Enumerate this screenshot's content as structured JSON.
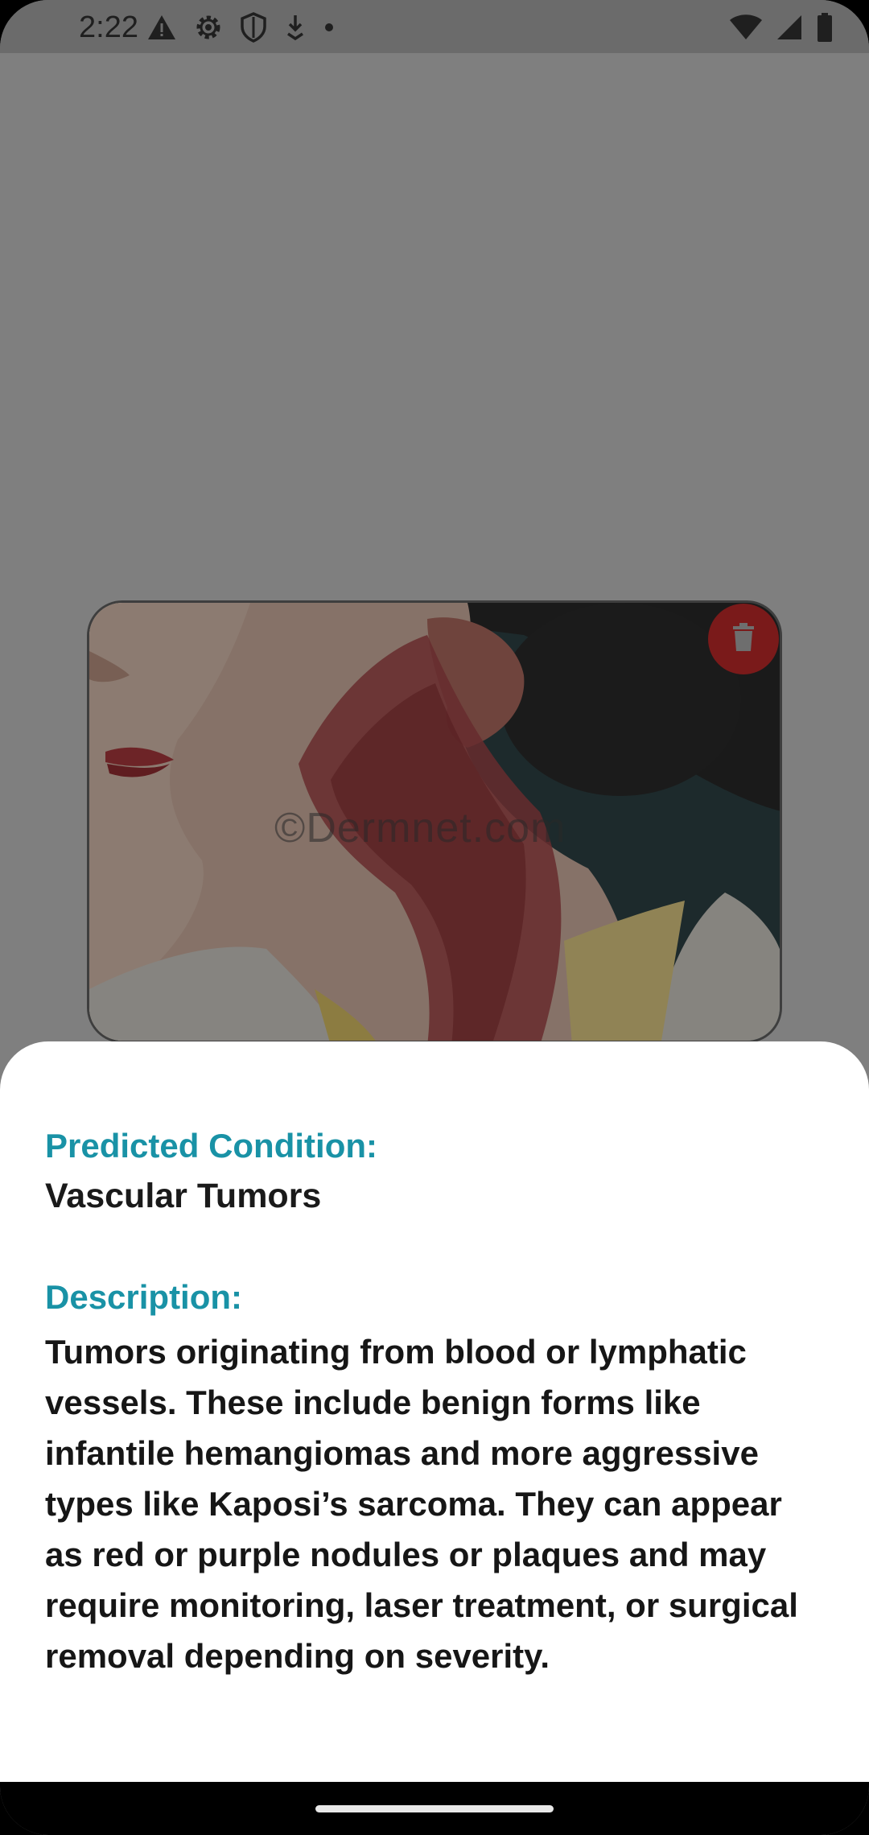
{
  "status_bar": {
    "time": "2:22",
    "left_icons": [
      "warning-icon",
      "gear-icon",
      "shield-icon",
      "download-icon",
      "dot-icon"
    ],
    "right_icons": [
      "wifi-icon",
      "signal-icon",
      "battery-icon"
    ]
  },
  "image": {
    "watermark": "©Dermnet.com",
    "delete_button_color": "#7a1a1a"
  },
  "result": {
    "condition_label": "Predicted Condition:",
    "condition_value": "Vascular Tumors",
    "description_label": "Description:",
    "description_text": "Tumors originating from blood or lymphatic vessels. These include benign forms like infantile hemangiomas and more aggressive types like Kaposi’s sarcoma. They can appear as red or purple nodules or plaques and may require monitoring, laser treatment, or surgical removal depending on severity."
  },
  "colors": {
    "accent": "#1992a6",
    "scrim": "#7f7f7f",
    "sheet": "#ffffff"
  }
}
